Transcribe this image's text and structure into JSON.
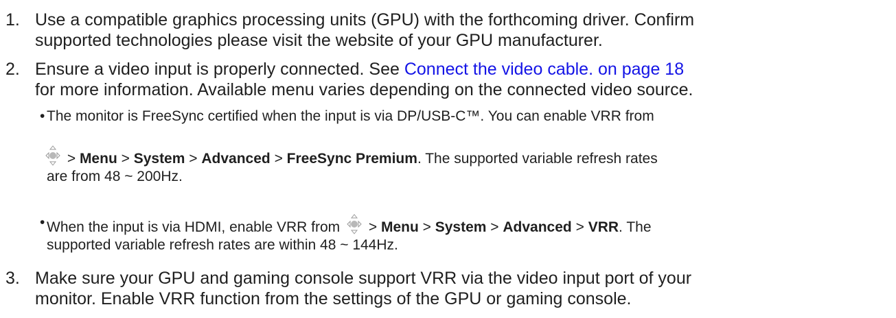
{
  "steps": [
    {
      "number": "1.",
      "lines": [
        "Use a compatible graphics processing units (GPU) with the forthcoming driver. Confirm",
        "supported technologies please visit the website of your GPU manufacturer."
      ]
    },
    {
      "number": "2.",
      "line1_text": "Ensure a video input is properly connected. See ",
      "link_text": "Connect the video cable. on page 18",
      "line2": "for more information. Available menu varies depending on the connected video source."
    },
    {
      "number": "3.",
      "lines": [
        "Make sure your GPU and gaming console support VRR via the video input port of your",
        "monitor. Enable VRR function from the settings of the GPU or gaming console."
      ]
    }
  ],
  "bullets": {
    "marker": "•",
    "freesync": {
      "intro": "The monitor is FreeSync certified when the input is via DP/USB-C™. You can enable VRR from",
      "sep": " > ",
      "menu": "Menu",
      "system": "System",
      "advanced": "Advanced",
      "target": "FreeSync Premium",
      "tail": ". The supported variable refresh rates",
      "line3": "are from 48 ~ 200Hz."
    },
    "hdmi": {
      "intro": "When the input is via HDMI, enable VRR from",
      "sep": " > ",
      "menu": "Menu",
      "system": "System",
      "advanced": "Advanced",
      "target": "VRR",
      "tail": ". The",
      "line2": "supported variable refresh rates are within 48 ~ 144Hz."
    }
  },
  "icons": {
    "joystick": "five-way-controller-icon"
  },
  "colors": {
    "text": "#1f1f1f",
    "link": "#1414e6"
  }
}
